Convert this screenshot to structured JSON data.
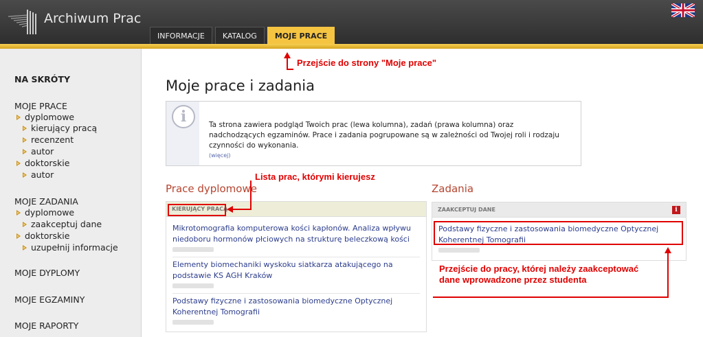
{
  "header": {
    "app_title": "Archiwum Prac",
    "tabs": [
      {
        "label": "INFORMACJE",
        "active": false
      },
      {
        "label": "KATALOG",
        "active": false
      },
      {
        "label": "MOJE PRACE",
        "active": true
      }
    ],
    "flag_icon": "uk-flag-icon"
  },
  "sidebar": {
    "heading": "NA SKRÓTY",
    "moje_prace": {
      "label": "MOJE PRACE",
      "items": [
        "dyplomowe",
        "kierujący pracą",
        "recenzent",
        "autor",
        "doktorskie",
        "autor"
      ]
    },
    "moje_zadania": {
      "label": "MOJE ZADANIA",
      "items": [
        "dyplomowe",
        "zaakceptuj dane",
        "doktorskie",
        "uzupełnij informacje"
      ]
    },
    "moje_dyplomy": "MOJE DYPLOMY",
    "moje_egzaminy": "MOJE EGZAMINY",
    "moje_raporty": "MOJE RAPORTY"
  },
  "main": {
    "title": "Moje prace i zadania",
    "info": {
      "icon": "info-icon",
      "text": "Ta strona zawiera podgląd Twoich prac (lewa kolumna), zadań (prawa kolumna) oraz nadchodzących egzaminów. Prace i zadania pogrupowane są w zależności od Twojej roli i rodzaju czynności do wykonania.",
      "more": "(więcej)"
    },
    "prace": {
      "title": "Prace dyplomowe",
      "role_header": "KIERUJĄCY PRACĄ",
      "works": [
        "Mikrotomografia komputerowa kości kapłonów. Analiza wpływu niedoboru hormonów płciowych na strukturę beleczkową kości",
        "Elementy biomechaniki wyskoku siatkarza atakującego na podstawie KS AGH Kraków",
        "Podstawy fizyczne i zastosowania biomedyczne Optycznej Koherentnej Tomografii"
      ]
    },
    "zadania": {
      "title": "Zadania",
      "task_header": "ZAAKCEPTUJ DANE",
      "task_icon": "alert-icon",
      "works": [
        "Podstawy fizyczne i zastosowania biomedyczne Optycznej Koherentnej Tomografii"
      ]
    }
  },
  "annotations": {
    "moje_prace": "Przejście do strony \"Moje prace\"",
    "lista_prac": "Lista prac, którymi kierujesz",
    "przejscie_line1": "Przejście do pracy, której należy zaakceptować",
    "przejscie_line2": "dane wprowadzone przez studenta"
  },
  "colors": {
    "accent_gold": "#f5c542",
    "annotation_red": "#e00000",
    "section_title": "#b5442f",
    "link": "#2c3d8c"
  }
}
